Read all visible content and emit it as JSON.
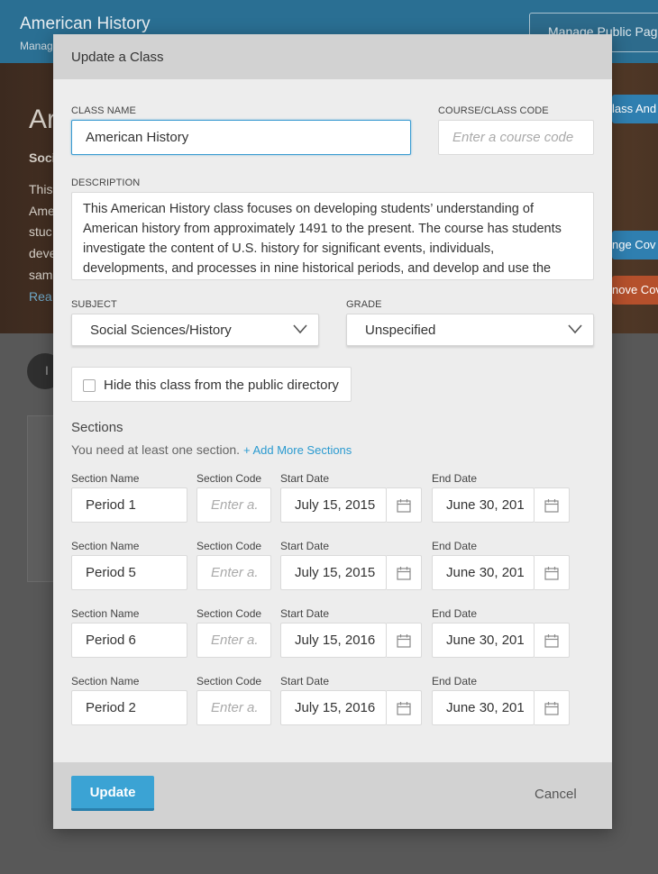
{
  "background": {
    "app_title": "American History",
    "app_subtitle": "Manag",
    "manage_button": "Manage Public Pag",
    "hero_title": "Ar",
    "hero_sub": "Soci",
    "hero_lines": [
      "This",
      "Ame",
      "stuc",
      "deve",
      "sam"
    ],
    "hero_link": "Rea",
    "btn_1": "lass And",
    "btn_2": "nge Cov",
    "btn_3": "nove Cov",
    "pill": "I"
  },
  "modal": {
    "title": "Update a Class",
    "class_name_label": "CLASS NAME",
    "class_name_value": "American History",
    "course_code_label": "COURSE/CLASS CODE",
    "course_code_placeholder": "Enter a course code",
    "description_label": "DESCRIPTION",
    "description_value": "This American History class focuses on developing students’ understanding of American history from approximately 1491 to the present. The course has students investigate the content of U.S. history for significant events, individuals, developments, and processes in nine historical periods, and develop and use the",
    "subject_label": "SUBJECT",
    "subject_value": "Social Sciences/History",
    "grade_label": "GRADE",
    "grade_value": "Unspecified",
    "hide_label": "Hide this class from the public directory",
    "sections_title": "Sections",
    "sections_note": "You need at least one section.",
    "add_sections_link": "+ Add More Sections",
    "col_labels": {
      "name": "Section Name",
      "code": "Section Code",
      "start": "Start Date",
      "end": "End Date"
    },
    "code_placeholder": "Enter a.",
    "sections": [
      {
        "name": "Period 1",
        "start": "July 15, 2015",
        "end": "June 30, 201"
      },
      {
        "name": "Period 5",
        "start": "July 15, 2015",
        "end": "June 30, 201"
      },
      {
        "name": "Period 6",
        "start": "July 15, 2016",
        "end": "June 30, 201"
      },
      {
        "name": "Period 2",
        "start": "July 15, 2016",
        "end": "June 30, 201"
      }
    ],
    "update_button": "Update",
    "cancel_button": "Cancel"
  }
}
